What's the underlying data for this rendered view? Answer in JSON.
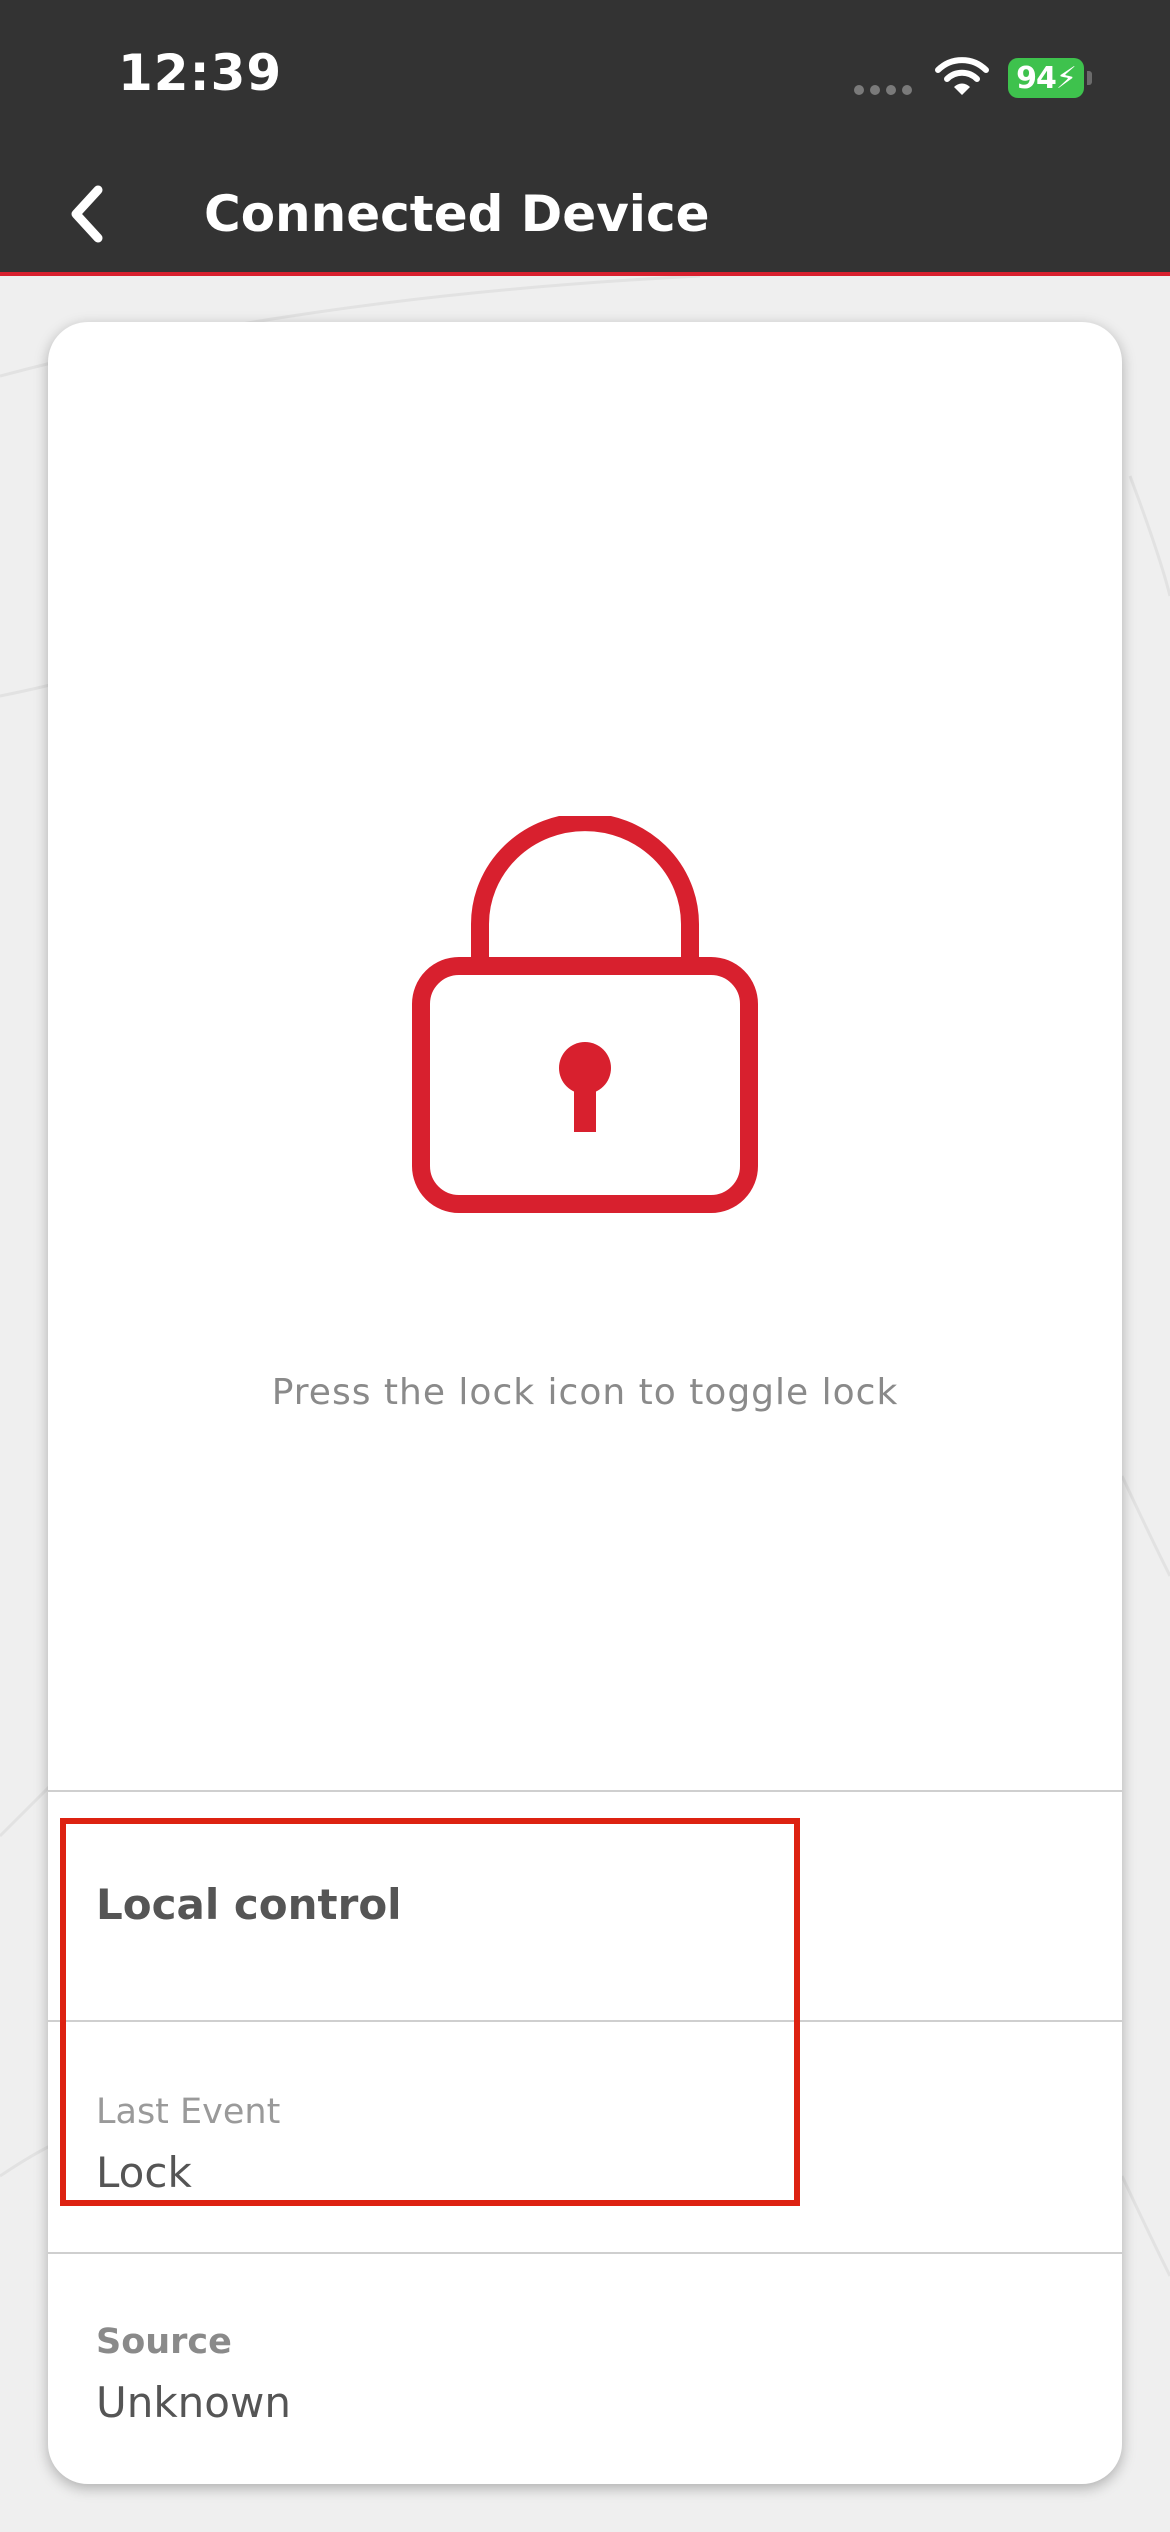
{
  "status_bar": {
    "time": "12:39",
    "battery": "94",
    "battery_color": "#3ec24d"
  },
  "nav": {
    "title": "Connected Device",
    "back_icon": "chevron-left-icon"
  },
  "lock": {
    "icon": "padlock-icon",
    "state": "locked",
    "hint": "Press the lock icon to toggle lock",
    "color": "#d8202e"
  },
  "local_control": {
    "title": "Local control",
    "last_event_label": "Last Event",
    "last_event_value": "Lock",
    "source_label": "Source",
    "source_value": "Unknown"
  },
  "colors": {
    "header_bg": "#333333",
    "accent": "#d8202e",
    "highlight": "#dd2211"
  }
}
